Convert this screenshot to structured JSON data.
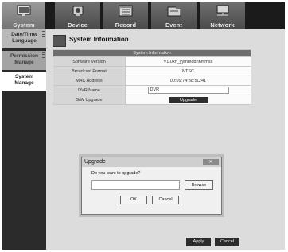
{
  "tabs": [
    {
      "label": "System",
      "icon": "monitor-icon"
    },
    {
      "label": "Device",
      "icon": "camera-icon"
    },
    {
      "label": "Record",
      "icon": "record-icon"
    },
    {
      "label": "Event",
      "icon": "event-icon"
    },
    {
      "label": "Network",
      "icon": "network-icon"
    }
  ],
  "active_tab": "System",
  "sidebar": {
    "items": [
      {
        "label_line1": "Date/Time/",
        "label_line2": "Language"
      },
      {
        "label_line1": "Permission",
        "label_line2": "Manage"
      },
      {
        "label_line1": "System",
        "label_line2": "Manage"
      }
    ]
  },
  "page": {
    "title": "System Information"
  },
  "info_table": {
    "header": "System Information",
    "rows": [
      {
        "label": "Software Version",
        "value": "V1.0xh_yymmddhhmmss"
      },
      {
        "label": "Broadcast Format",
        "value": "NTSC"
      },
      {
        "label": "MAC Address",
        "value": "00:09:74:88:5C:41"
      },
      {
        "label": "DVR Name",
        "value": "DVR"
      },
      {
        "label": "S/W Upgrade",
        "value": "Upgrade"
      }
    ]
  },
  "dialog": {
    "title": "Upgrade",
    "question": "Do you want to upgrade?",
    "path_value": "",
    "browse_label": "Browse",
    "ok_label": "OK",
    "cancel_label": "Cancel"
  },
  "footer": {
    "apply_label": "Apply",
    "cancel_label": "Cancel"
  }
}
